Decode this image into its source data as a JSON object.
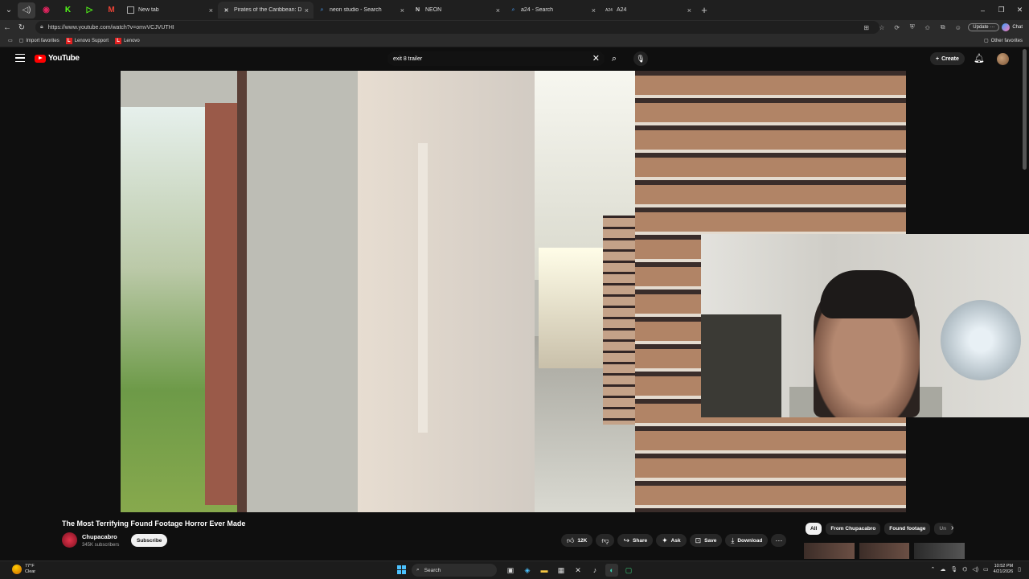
{
  "browser": {
    "tabs": [
      {
        "label": "New tab",
        "icon": "newtab-icon"
      },
      {
        "label": "Pirates of the Caribbean: Dead Me",
        "icon": "x-icon",
        "active": true
      },
      {
        "label": "neon studio - Search",
        "icon": "search-icon"
      },
      {
        "label": "NEON",
        "icon": "neon-icon"
      },
      {
        "label": "a24 - Search",
        "icon": "search-icon"
      },
      {
        "label": "A24",
        "icon": "a24-icon"
      }
    ],
    "url": "https://www.youtube.com/watch?v=omvVCJVUTHI",
    "update_label": "Update",
    "chat_label": "Chat",
    "favorites": [
      "Import favorites",
      "Lenovo Support",
      "Lenovo"
    ],
    "other_favorites": "Other favorites"
  },
  "youtube": {
    "logo_text": "YouTube",
    "search_value": "exit 8 trailer",
    "create_label": "Create"
  },
  "video": {
    "title": "The Most Terrifying Found Footage Horror Ever Made",
    "channel": "Chupacabro",
    "subscribers": "345K subscribers",
    "subscribe_label": "Subscribe",
    "likes": "12K",
    "share_label": "Share",
    "ask_label": "Ask",
    "save_label": "Save",
    "download_label": "Download"
  },
  "chips": [
    "All",
    "From Chupacabro",
    "Found footage",
    "Un"
  ],
  "taskbar": {
    "temp": "77°F",
    "weather": "Clear",
    "search_label": "Search",
    "time": "10:52 PM",
    "date": "4/21/2026"
  },
  "colors": {
    "youtube_red": "#ff0000",
    "bg": "#0f0f0f",
    "chip_bg": "#272727"
  }
}
